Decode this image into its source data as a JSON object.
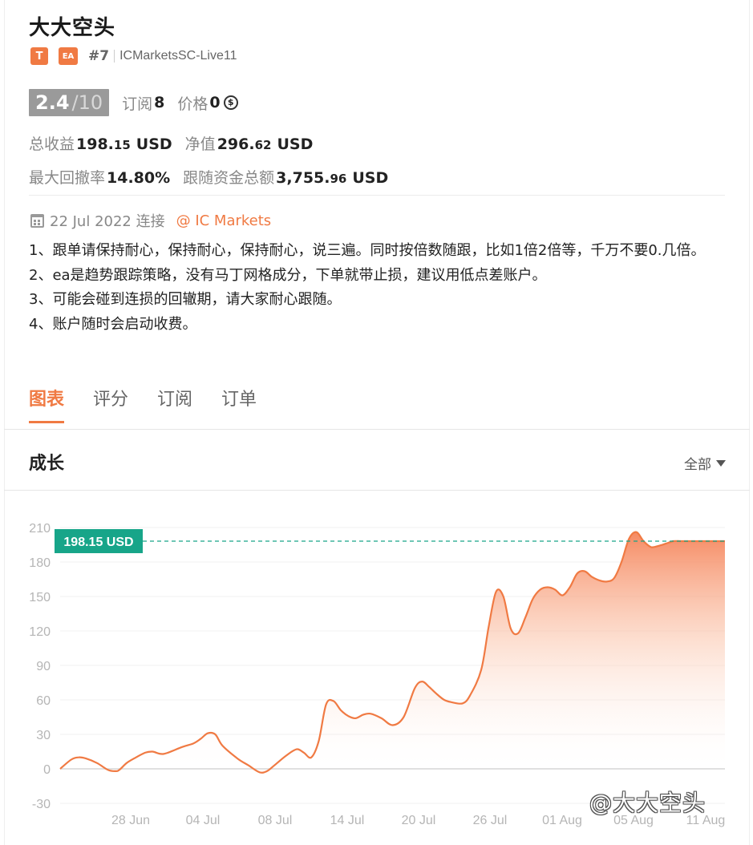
{
  "profile": {
    "name": "大大空头",
    "tag_t": "T",
    "tag_ea": "EA",
    "rank": "#7",
    "server": "ICMarketsSC-Live11"
  },
  "rating": {
    "score": "2.4",
    "max": "/10",
    "subs_label": "订阅",
    "subs_value": "8",
    "price_label": "价格",
    "price_value": "0",
    "coin_symbol": "$"
  },
  "stats": {
    "total_profit_label": "总收益",
    "total_profit_int": "198.",
    "total_profit_dec": "15",
    "total_profit_unit": "USD",
    "equity_label": "净值",
    "equity_int": "296.",
    "equity_dec": "62",
    "equity_unit": "USD",
    "drawdown_label": "最大回撤率",
    "drawdown_value": "14.80%",
    "follow_label": "跟随资金总额",
    "follow_int": "3,755.",
    "follow_dec": "96",
    "follow_unit": "USD"
  },
  "connection": {
    "since": "22 Jul 2022 连接",
    "broker": "@ IC Markets"
  },
  "description": [
    "1、跟单请保持耐心，保持耐心，保持耐心，说三遍。同时按倍数随跟，比如1倍2倍等，千万不要0.几倍。",
    "2、ea是趋势跟踪策略，没有马丁网格成分，下单就带止损，建议用低点差账户。",
    "3、可能会碰到连损的回辙期，请大家耐心跟随。",
    "4、账户随时会启动收费。"
  ],
  "tabs": [
    "图表",
    "评分",
    "订阅",
    "订单"
  ],
  "active_tab": "图表",
  "section": {
    "title": "成长",
    "filter": "全部"
  },
  "watermark": "@大大空头",
  "colors": {
    "accent": "#f07a43",
    "value_badge": "#17a589"
  },
  "chart_data": {
    "type": "area",
    "title": "",
    "xlabel": "",
    "ylabel": "",
    "ylim": [
      -30,
      210
    ],
    "yticks": [
      210,
      180,
      150,
      120,
      90,
      60,
      30,
      0,
      -30
    ],
    "xticks": [
      "28 Jun",
      "04 Jul",
      "08 Jul",
      "14 Jul",
      "20 Jul",
      "26 Jul",
      "01 Aug",
      "05 Aug",
      "11 Aug"
    ],
    "current_value": 198.15,
    "current_label": "198.15 USD",
    "series": [
      {
        "x": [
          0,
          1.5,
          2.5,
          3.5,
          5,
          6.5,
          7.5,
          8,
          9,
          10,
          11.5,
          12.5,
          14,
          16.5,
          18,
          19,
          20,
          21,
          22,
          24,
          25.5,
          27,
          28,
          29,
          30.5,
          32,
          33,
          34,
          35,
          36,
          37,
          38,
          39,
          40,
          41,
          42,
          43.5,
          45,
          46.5,
          48,
          49,
          50,
          51,
          52,
          53,
          54.5,
          55.5,
          57,
          58,
          59,
          60,
          61,
          62,
          63,
          64,
          65,
          66,
          67,
          68,
          69,
          70,
          71,
          72,
          73,
          74,
          75,
          76,
          77,
          78,
          79,
          80,
          81,
          82,
          83,
          84,
          85,
          86,
          87,
          88,
          89,
          90
        ],
        "values": [
          0,
          8,
          10,
          9,
          5,
          -1,
          -2,
          -1,
          5,
          9,
          14,
          15,
          13,
          19,
          22,
          26,
          31,
          30,
          20,
          9,
          3,
          -3,
          -2,
          3,
          11,
          17,
          14,
          10,
          24,
          56,
          59,
          51,
          46,
          44,
          47,
          48,
          44,
          38,
          45,
          70,
          76,
          71,
          65,
          60,
          58,
          57,
          64,
          86,
          123,
          154,
          150,
          122,
          118,
          132,
          148,
          156,
          158,
          156,
          151,
          158,
          170,
          172,
          167,
          164,
          163,
          166,
          180,
          200,
          206,
          198,
          193,
          194,
          196,
          198.15,
          198.15,
          198.15,
          198.15,
          198.15,
          198.15,
          198.15,
          198.15
        ]
      }
    ]
  }
}
